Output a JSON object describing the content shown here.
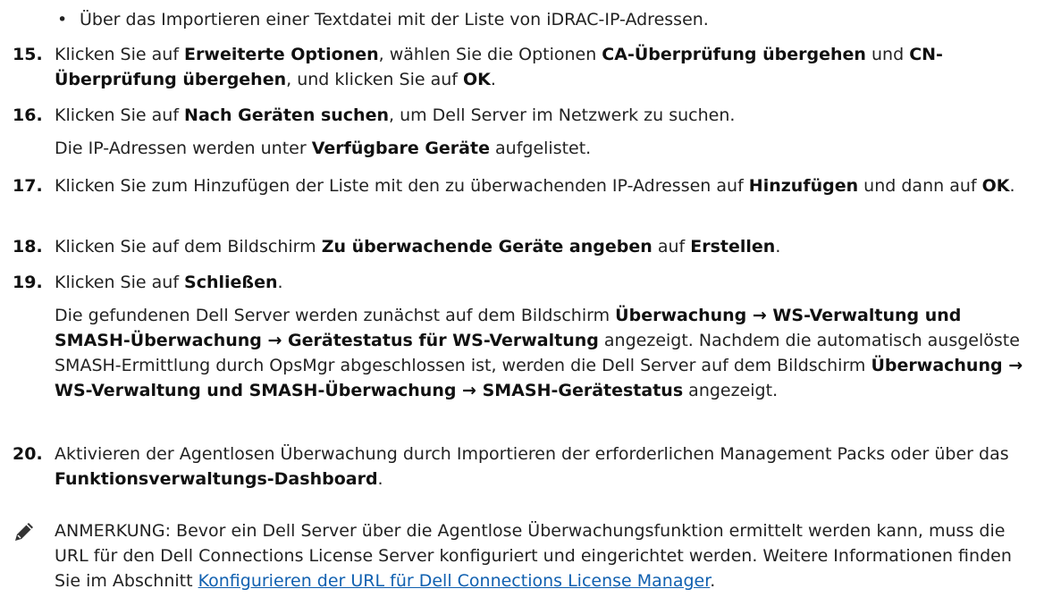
{
  "bullet": {
    "text": "Über das Importieren einer Textdatei mit der Liste von iDRAC-IP-Adressen."
  },
  "steps": [
    {
      "num": "15.",
      "t1": "Klicken Sie auf ",
      "b1": "Erweiterte Optionen",
      "t2": ", wählen Sie die Optionen ",
      "b2": "CA-Überprüfung übergehen",
      "t3": " und ",
      "b3": "CN-Überprüfung übergehen",
      "t4": ", und klicken Sie auf ",
      "b4": "OK",
      "t5": "."
    },
    {
      "num": "16.",
      "t1": "Klicken Sie auf ",
      "b1": "Nach Geräten suchen",
      "t2": ", um Dell Server im Netzwerk zu suchen.",
      "p2_t1": "Die IP-Adressen werden unter ",
      "p2_b1": "Verfügbare Geräte",
      "p2_t2": " aufgelistet."
    },
    {
      "num": "17.",
      "t1": "Klicken Sie zum Hinzufügen der Liste mit den zu überwachenden IP-Adressen auf ",
      "b1": "Hinzufügen",
      "t2": " und dann auf ",
      "b2": "OK",
      "t3": "."
    },
    {
      "num": "18.",
      "t1": "Klicken Sie auf dem Bildschirm ",
      "b1": "Zu überwachende Geräte angeben",
      "t2": " auf ",
      "b2": "Erstellen",
      "t3": "."
    },
    {
      "num": "19.",
      "t1": "Klicken Sie auf ",
      "b1": "Schließen",
      "t2": ".",
      "p2_t1": "Die gefundenen Dell Server werden zunächst auf dem Bildschirm ",
      "p2_b1": "Überwachung → WS-Verwaltung und SMASH-Überwachung → Gerätestatus für WS-Verwaltung",
      "p2_t2": " angezeigt. Nachdem die automatisch ausgelöste SMASH-Ermittlung durch OpsMgr abgeschlossen ist, werden die Dell Server auf dem Bildschirm ",
      "p2_b2": "Überwachung → WS-Verwaltung und SMASH-Überwachung → SMASH-Gerätestatus",
      "p2_t3": " angezeigt."
    },
    {
      "num": "20.",
      "t1": "Aktivieren der Agentlosen Überwachung durch Importieren der erforderlichen Management Packs oder über das ",
      "b1": "Funktionsverwaltungs-Dashboard",
      "t2": "."
    }
  ],
  "note": {
    "icon": "pencil-icon",
    "label": "ANMERKUNG:",
    "text": " Bevor ein Dell Server über die Agentlose Überwachungsfunktion ermittelt werden kann, muss die URL für den Dell Connections License Server konfiguriert und eingerichtet werden. Weitere Informationen finden Sie im Abschnitt ",
    "link": "Konfigurieren der URL für Dell Connections License Manager",
    "end": "."
  },
  "colors": {
    "link": "#1060b0",
    "text": "#222222"
  }
}
